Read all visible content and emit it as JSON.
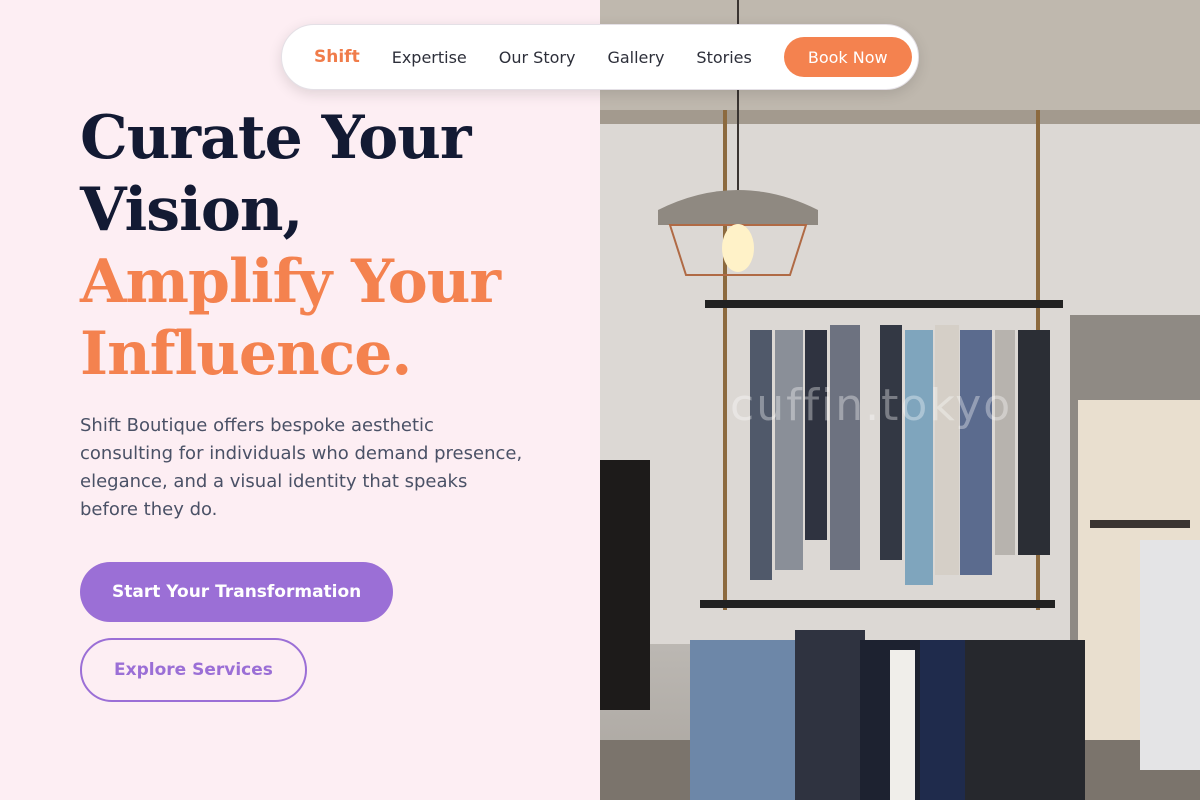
{
  "nav": {
    "brand": "Shift",
    "links": [
      "Expertise",
      "Our Story",
      "Gallery",
      "Stories"
    ],
    "cta": "Book Now"
  },
  "hero": {
    "headline_line1": "Curate Your",
    "headline_line2": "Vision,",
    "headline_line3": "Amplify Your",
    "headline_line4": "Influence.",
    "description": "Shift Boutique offers bespoke aesthetic consulting for individuals who demand presence, elegance, and a visual identity that speaks before they do.",
    "primary_button": "Start Your Transformation",
    "secondary_button": "Explore Services"
  },
  "image": {
    "watermark": "cuffin.tokyo"
  },
  "colors": {
    "accent": "#f4824f",
    "purple": "#9b6fd6",
    "headline_dark": "#131a33",
    "background": "#fdeef3"
  }
}
